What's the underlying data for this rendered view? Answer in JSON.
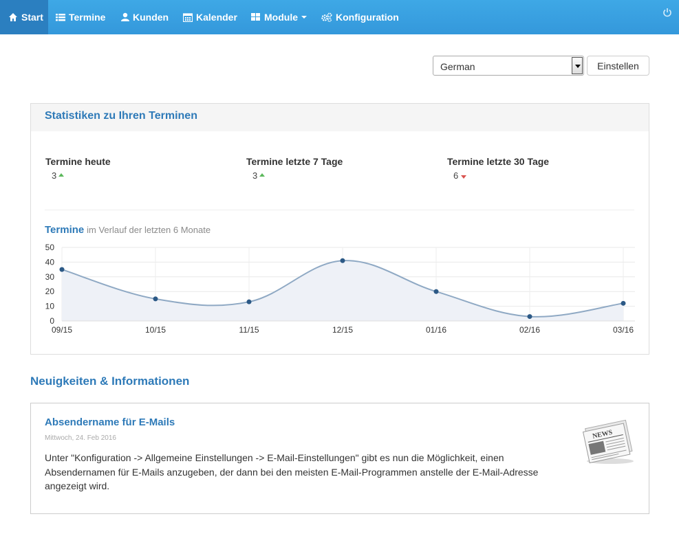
{
  "nav": {
    "items": [
      {
        "label": "Start",
        "icon": "home-icon"
      },
      {
        "label": "Termine",
        "icon": "list-icon"
      },
      {
        "label": "Kunden",
        "icon": "user-icon"
      },
      {
        "label": "Kalender",
        "icon": "calendar-icon"
      },
      {
        "label": "Module",
        "icon": "grid-icon"
      },
      {
        "label": "Konfiguration",
        "icon": "gears-icon"
      }
    ],
    "power_icon": "power-icon",
    "bar_color": "#3498db",
    "active_color": "#2b7fc0"
  },
  "language": {
    "selected": "German",
    "set_button": "Einstellen"
  },
  "stats": {
    "title": "Statistiken zu Ihren Terminen",
    "items": [
      {
        "label": "Termine heute",
        "value": "3",
        "trend": "up"
      },
      {
        "label": "Termine letzte 7 Tage",
        "value": "3",
        "trend": "up"
      },
      {
        "label": "Termine letzte 30 Tage",
        "value": "6",
        "trend": "down"
      }
    ],
    "chart_title_main": "Termine",
    "chart_title_sub": "im Verlauf der letzten 6 Monate"
  },
  "chart_data": {
    "type": "area",
    "categories": [
      "09/15",
      "10/15",
      "11/15",
      "12/15",
      "01/16",
      "02/16",
      "03/16"
    ],
    "series": [
      {
        "values": [
          35,
          15,
          13,
          41,
          20,
          3,
          12
        ]
      }
    ],
    "yticks": [
      "0",
      "10",
      "20",
      "30",
      "40",
      "50"
    ],
    "ylim": [
      0,
      50
    ],
    "grid": true,
    "line_color": "#8fa9c4",
    "point_color": "#2c5986",
    "fill_color": "#eef1f7"
  },
  "news": {
    "heading": "Neuigkeiten & Informationen",
    "title": "Absendername für E-Mails",
    "date": "Mittwoch, 24. Feb 2016",
    "body": "Unter \"Konfiguration -> Allgemeine Einstellungen -> E-Mail-Einstellungen\" gibt es nun die Möglichkeit, einen Absendernamen für E-Mails anzugeben, der dann bei den meisten E-Mail-Programmen anstelle der E-Mail-Adresse angezeigt wird.",
    "image_icon": "newspaper-icon",
    "image_text": "NEWS"
  }
}
